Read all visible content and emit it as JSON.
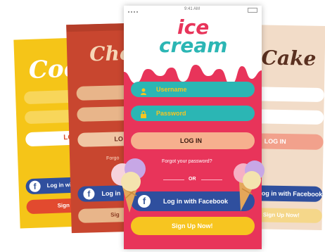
{
  "cookie_screen": {
    "brand": "Coo",
    "login_label": "LOG",
    "facebook_label": "Log in with",
    "signup_label": "Sign",
    "colors": {
      "bg": "#f5c518",
      "facebook": "#2f4f9e",
      "signup": "#e24a2f"
    }
  },
  "chocolate_screen": {
    "brand": "Cho",
    "login_label": "LO",
    "forgot_label": "Forgo",
    "facebook_label": "Log in",
    "signup_label": "Sig",
    "colors": {
      "bg": "#c8462f",
      "field": "#e8b58a",
      "facebook": "#2f4f9e"
    }
  },
  "ice_cream_screen": {
    "status_time": "9:41 AM",
    "brand_line1": "ice",
    "brand_line2": "cream",
    "username_placeholder": "Username",
    "password_placeholder": "Password",
    "login_label": "LOG IN",
    "forgot_label": "Forgot your password?",
    "or_label": "OR",
    "facebook_label": "Log in with Facebook",
    "signup_label": "Sign Up Now!",
    "icons": {
      "username": "user-icon",
      "password": "lock-icon",
      "facebook": "facebook-icon"
    },
    "colors": {
      "bg": "#e8345a",
      "field": "#2bb6b4",
      "login": "#f6b08e",
      "facebook": "#2f4f9e",
      "signup": "#f7c520"
    }
  },
  "cake_screen": {
    "brand": "Cake",
    "login_label": "LOG IN",
    "facebook_label": "Log in with Facebook",
    "signup_label": "Sign Up Now!",
    "colors": {
      "bg": "#f2dcc8",
      "field": "#ffffff",
      "login": "#f2a18c",
      "facebook": "#2f4f9e",
      "signup": "#f5d78a"
    }
  }
}
